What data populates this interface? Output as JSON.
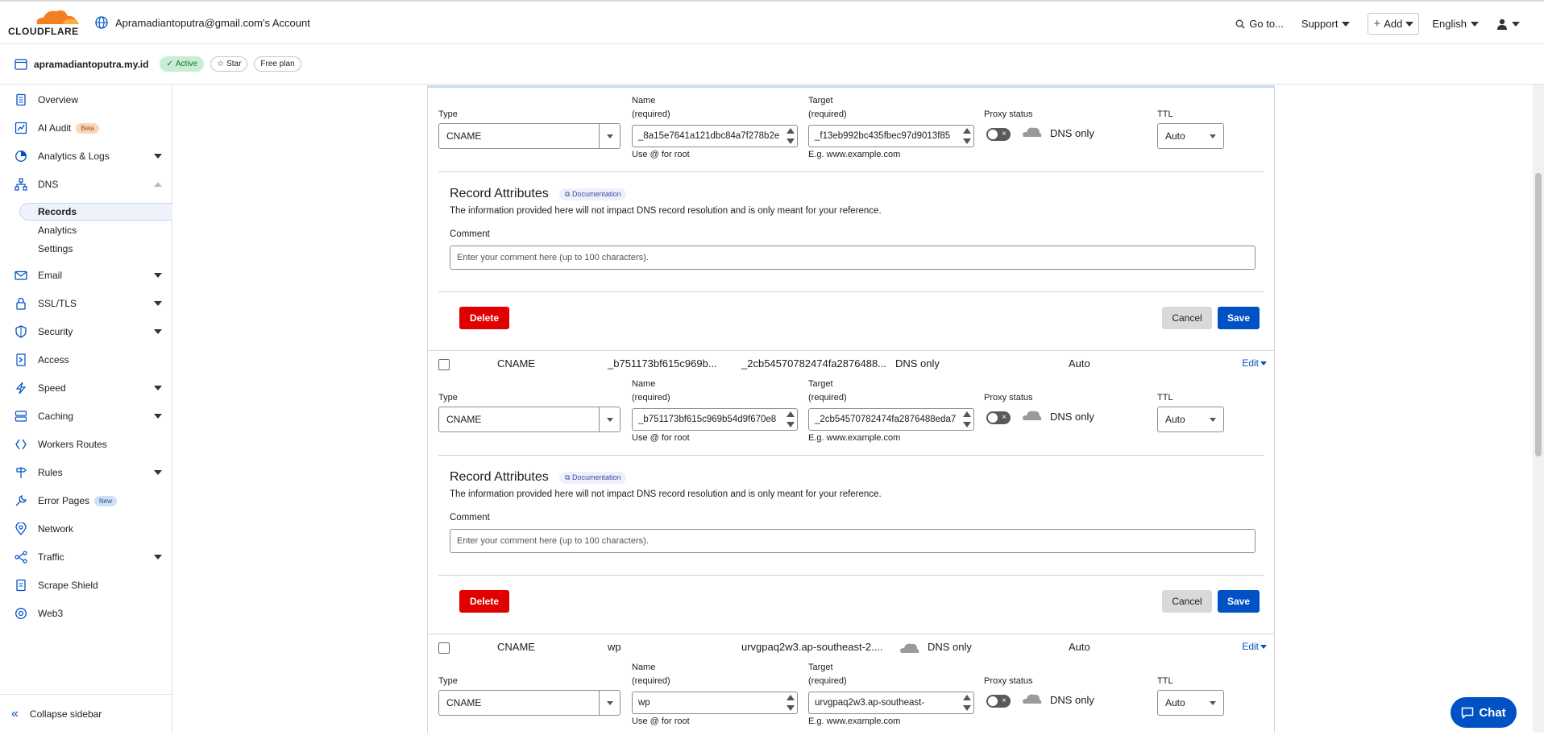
{
  "header": {
    "logo_text": "CLOUDFLARE",
    "account": "Apramadiantoputra@gmail.com's Account",
    "goto": "Go to...",
    "support": "Support",
    "add": "Add",
    "language": "English"
  },
  "zone": {
    "name": "apramadiantoputra.my.id",
    "status": "Active",
    "star": "Star",
    "plan": "Free plan"
  },
  "sidebar": {
    "items": [
      {
        "label": "Overview"
      },
      {
        "label": "AI Audit",
        "badge": "Beta"
      },
      {
        "label": "Analytics & Logs"
      },
      {
        "label": "DNS"
      },
      {
        "label": "Email"
      },
      {
        "label": "SSL/TLS"
      },
      {
        "label": "Security"
      },
      {
        "label": "Access"
      },
      {
        "label": "Speed"
      },
      {
        "label": "Caching"
      },
      {
        "label": "Workers Routes"
      },
      {
        "label": "Rules"
      },
      {
        "label": "Error Pages",
        "badge": "New"
      },
      {
        "label": "Network"
      },
      {
        "label": "Traffic"
      },
      {
        "label": "Scrape Shield"
      },
      {
        "label": "Web3"
      }
    ],
    "dns_sub": [
      "Records",
      "Analytics",
      "Settings"
    ],
    "collapse": "Collapse sidebar"
  },
  "form_labels": {
    "type": "Type",
    "name": "Name",
    "required": "(required)",
    "target": "Target",
    "proxy_status": "Proxy status",
    "ttl": "TTL",
    "name_hint": "Use @ for root",
    "target_hint": "E.g. www.example.com",
    "dns_only": "DNS only"
  },
  "attributes": {
    "title": "Record Attributes",
    "doc": "Documentation",
    "desc": "The information provided here will not impact DNS record resolution and is only meant for your reference.",
    "comment_label": "Comment",
    "comment_placeholder": "Enter your comment here (up to 100 characters)."
  },
  "buttons": {
    "delete": "Delete",
    "cancel": "Cancel",
    "save": "Save",
    "edit": "Edit"
  },
  "records": [
    {
      "type": "CNAME",
      "name_input": "_8a15e7641a121dbc84a7f278b2e",
      "target_input": "_f13eb992bc435fbec97d9013f85",
      "ttl": "Auto"
    },
    {
      "type": "CNAME",
      "name_short": "_b751173bf615c969b...",
      "target_short": "_2cb54570782474fa2876488...",
      "proxy": "DNS only",
      "ttl": "Auto",
      "name_input": "_b751173bf615c969b54d9f670e8",
      "target_input": "_2cb54570782474fa2876488eda7"
    },
    {
      "type": "CNAME",
      "name_short": "wp",
      "target_short": "urvgpaq2w3.ap-southeast-2....",
      "proxy": "DNS only",
      "ttl": "Auto",
      "name_input": "wp",
      "target_input": "urvgpaq2w3.ap-southeast-"
    }
  ],
  "chat": "Chat"
}
